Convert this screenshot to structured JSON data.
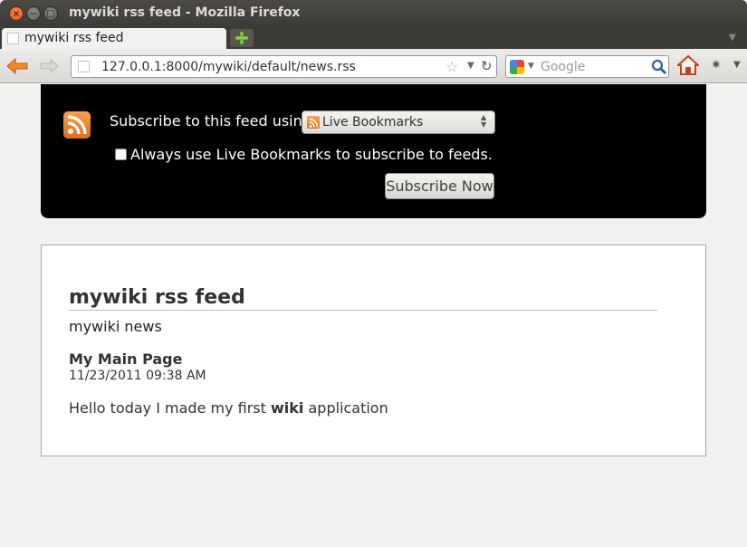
{
  "window": {
    "title": "mywiki rss feed - Mozilla Firefox"
  },
  "tabs": [
    {
      "label": "mywiki rss feed"
    }
  ],
  "navbar": {
    "url": "127.0.0.1:8000/mywiki/default/news.rss",
    "search_placeholder": "Google"
  },
  "feed_header": {
    "subscribe_label": "Subscribe to this feed using",
    "reader_selected": "Live Bookmarks",
    "always_use_label": "Always use Live Bookmarks to subscribe to feeds.",
    "always_use_checked": false,
    "subscribe_button": "Subscribe Now"
  },
  "feed": {
    "title": "mywiki rss feed",
    "subtitle": "mywiki news",
    "entries": [
      {
        "title": "My Main Page",
        "date": "11/23/2011 09:38 AM",
        "content_before": "Hello today I made my first ",
        "content_bold": "wiki",
        "content_after": " application"
      }
    ]
  },
  "colors": {
    "rss_orange": "#e8791e",
    "header_bg": "#000000",
    "titlebar_bg": "#3c3b37",
    "close_button": "#e8632a"
  },
  "icons": [
    "close-icon",
    "minimize-icon",
    "maximize-icon",
    "new-tab-icon",
    "back-arrow-icon",
    "forward-arrow-icon",
    "bookmark-star-icon",
    "reload-icon",
    "google-icon",
    "search-icon",
    "home-icon",
    "addon-icon",
    "rss-icon"
  ]
}
